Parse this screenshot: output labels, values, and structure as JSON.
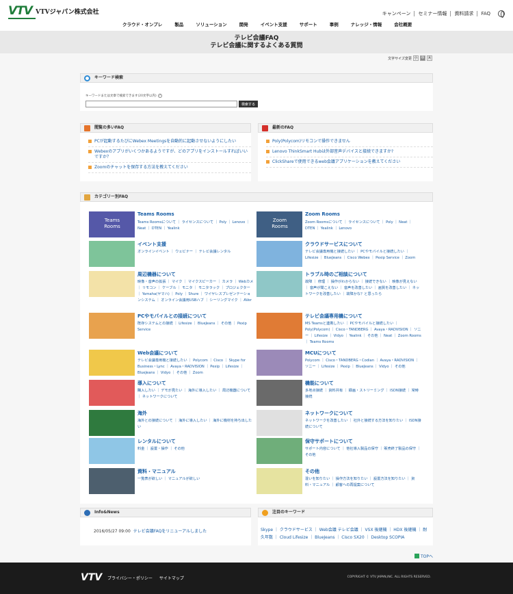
{
  "header": {
    "logo_text": "VTV",
    "company": "VTVジャパン株式会社",
    "util": [
      "キャンペーン",
      "セミナー情報",
      "資料請求",
      "FAQ"
    ],
    "gnav": [
      "クラウド・オンプレ",
      "製品",
      "ソリューション",
      "開発",
      "イベント支援",
      "サポート",
      "事例",
      "ナレッジ・情報",
      "会社概要"
    ]
  },
  "titlebar": {
    "line1": "テレビ会議FAQ",
    "line2": "テレビ会議に関するよくある質問"
  },
  "font_size": {
    "label": "文字サイズ変更",
    "buttons": [
      "小",
      "中",
      "大"
    ]
  },
  "keyword_search": {
    "title": "キーワード検索",
    "hint": "キーワードまたは文章で検索できます(20文字以内)",
    "help": "?",
    "input_value": "",
    "button": "検索する"
  },
  "popular": {
    "title": "閲覧の多いFAQ",
    "items": [
      "PCが起動するたびにWebex Meetingsを自動的に起動させないようにしたい",
      "Webexのアプリがいくつかあるようですが、どのアプリをインストールすればいいですか？",
      "Zoomのチャットを保存する方法を教えてください"
    ]
  },
  "newest": {
    "title": "最新のFAQ",
    "items": [
      "Poly(Polycom)リモコンで操作できません",
      "Lenovo ThinkSmart Hubは外部音声デバイスと接続できますか?",
      "ClickShareで使用できるweb会議アプリケーションを教えてください"
    ]
  },
  "category": {
    "title": "カテゴリー別FAQ",
    "cards": [
      {
        "title": "Teams Rooms",
        "links": "Teams Roomsについて ｜ ライセンスについて ｜ Poly ｜ Lenovo ｜ Neat ｜ DTEN ｜ Yealink",
        "thumb_text": "Teams Rooms",
        "color": "#5558a8",
        "icon": "teams-rooms-icon"
      },
      {
        "title": "Zoom Rooms",
        "links": "Zoom Roomsについて ｜ ライセンスについて ｜ Poly ｜ Neat ｜ DTEN ｜ Yealink ｜ Lenovo",
        "thumb_text": "Zoom Rooms",
        "color": "#3f5f84",
        "icon": "zoom-rooms-icon"
      },
      {
        "title": "イベント支援",
        "links": "オンラインイベント ｜ ウェビナー ｜ テレビ会議レンタル",
        "thumb_text": "",
        "color": "#7ec49a",
        "icon": "handshake-icon"
      },
      {
        "title": "クラウドサービスについて",
        "links": "テレビ会議専用機と接続したい ｜ PCやモバイルと接続したい ｜ Lifesize ｜ BlueJeans ｜ Cisco Webex ｜ Pexip Service ｜ Zoom",
        "thumb_text": "",
        "color": "#7fb3de",
        "icon": "cloud-icon"
      },
      {
        "title": "周辺機器について",
        "links": "映像・音声の拡張 ｜ マイク ｜ マイクスピーカー ｜ カメラ ｜ Webカメ ｜ リモコン ｜ ケーブル ｜ モニタ ｜ モニタラック ｜ プロジェクター ｜ Yamaha(ヤマハ) ｜ Poly ｜ Shure ｜ ワイヤレスプレゼンテーションシステム ｜ オンライン会議用USBハブ ｜ シーリングマイク ｜ AVer",
        "thumb_text": "",
        "color": "#f3e2a8",
        "icon": "microphone-icon"
      },
      {
        "title": "トラブル時のご相談について",
        "links": "故障 ｜ 修理 ｜ 操作がわからない ｜ 接続できない ｜ 映像が見えない ｜ 音声が聞こえない ｜ 音声を改善したい ｜ 画質を改善したい ｜ ネットワークを改善したい ｜ 故障かな？と思ったら",
        "thumb_text": "",
        "color": "#8fc7c7",
        "icon": "screwdriver-icon"
      },
      {
        "title": "PCやモバイルとの接続について",
        "links": "既存システムとの接続 ｜ Lifesize ｜ BlueJeans ｜ その他 ｜ Pexip Service",
        "thumb_text": "",
        "color": "#e8a24e",
        "icon": "pc-mobile-icon"
      },
      {
        "title": "テレビ会議専用機について",
        "links": "MS Teamsと連携したい ｜ PCやモバイルと接続したい ｜ Poly(Polycom) ｜ Cisco・TANDBERG ｜ Avaya・RADVISION ｜ ソニー ｜ Lifesize ｜ Vidyo ｜ Yealink ｜ その他 ｜ Neat ｜ Zoom Rooms ｜ Teams Rooms",
        "thumb_text": "",
        "color": "#e07b35",
        "icon": "monitor-icon"
      },
      {
        "title": "Web会議について",
        "links": "テレビ会議専用機と接続したい ｜ Polycom ｜ Cisco ｜ Skype for Business・Lync ｜ Avaya・RADVISION ｜ Pexip ｜ Lifesize ｜ BlueJeans ｜ Vidyo ｜ その他 ｜ Zoom",
        "thumb_text": "",
        "color": "#f0c84a",
        "icon": "laptop-icon"
      },
      {
        "title": "MCUについて",
        "links": "Polycom ｜ Cisco・TANDBERG・Codian ｜ Avaya・RADVISION ｜ ソニー ｜ Lifesize ｜ Pexip ｜ BlueJeans ｜ Vidyo ｜ その他",
        "thumb_text": "",
        "color": "#9b8ab8",
        "icon": "server-icon"
      },
      {
        "title": "導入について",
        "links": "購入したい ｜ デモが見たい ｜ 海外に導入したい ｜ 周辺機器について ｜ ネットワークについて",
        "thumb_text": "",
        "color": "#e15a5a",
        "icon": "cart-icon"
      },
      {
        "title": "機能について",
        "links": "多地点接続 ｜ 資料共有 ｜ 録画・ストリーミング ｜ ISDN接続 ｜ 常時接続",
        "thumb_text": "",
        "color": "#6a6a6a",
        "icon": "gear-icon"
      },
      {
        "title": "海外",
        "links": "海外との接続について ｜ 海外に導入したい ｜ 海外に機材を持ち出したい",
        "thumb_text": "",
        "color": "#2f7a3e",
        "icon": "airplane-icon"
      },
      {
        "title": "ネットワークについて",
        "links": "ネットワークを改善したい ｜ 社外と接続する方法を知りたい ｜ ISDN接続について",
        "thumb_text": "",
        "color": "#e0e0e0",
        "icon": "firewall-icon"
      },
      {
        "title": "レンタルについて",
        "links": "料金 ｜ 設置・操作 ｜ その他",
        "thumb_text": "",
        "color": "#8fc6e6",
        "icon": "suitcase-icon"
      },
      {
        "title": "保守サポートについて",
        "links": "サポート内容について ｜ 他社導入製品の保守 ｜ 販売終了製品の保守 ｜ その他",
        "thumb_text": "",
        "color": "#6fae7a",
        "icon": "support-handshake-icon"
      },
      {
        "title": "資料・マニュアル",
        "links": "一覧表が欲しい ｜ マニュアルが欲しい",
        "thumb_text": "",
        "color": "#4d5f6e",
        "icon": "binders-icon"
      },
      {
        "title": "その他",
        "links": "違いを知りたい ｜ 操作方法を知りたい ｜ 設置方法を知りたい ｜ 資料・マニュアル ｜ 顧客への再提案について",
        "thumb_text": "",
        "color": "#e6e3a0",
        "icon": "magnifier-icon"
      }
    ]
  },
  "info": {
    "title": "Info&News",
    "date": "2016/05/27 09:00",
    "link": "テレビ会議FAQをリニューアルしました"
  },
  "attention": {
    "title": "注目のキーワード",
    "keywords": "Skype ｜ クラウドサービス ｜ Web会議 テレビ会議 ｜ VSX 後継機 ｜ HDX 後継機 ｜ 耐久年数 ｜ Cloud Lifesize ｜ BlueJeans ｜ Cisco SX20 ｜ Desktop SCOPIA"
  },
  "totop": "TOPへ",
  "footer": {
    "logo": "VTV",
    "links": [
      "プライバシー・ポリシー",
      "サイトマップ"
    ],
    "copyright": "COPYRIGHT © VTV JAPAN,INC. ALL RIGHTS RESERVED."
  }
}
